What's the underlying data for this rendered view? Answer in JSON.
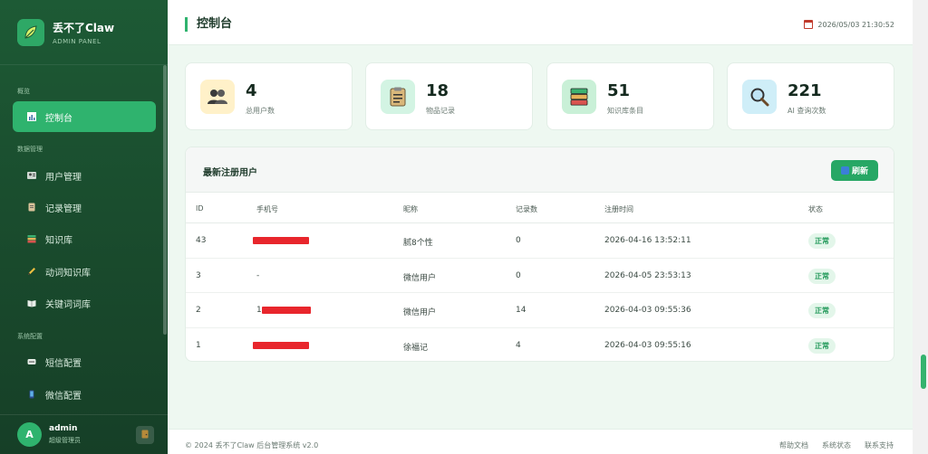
{
  "brand": {
    "title": "丢不了Claw",
    "subtitle": "ADMIN PANEL"
  },
  "sidebar": {
    "sections": [
      {
        "label": "概览"
      },
      {
        "label": "数据管理"
      },
      {
        "label": "系统配置"
      }
    ],
    "items": [
      {
        "label": "控制台",
        "icon": "chart-icon",
        "active": true
      },
      {
        "label": "用户管理",
        "icon": "users-icon"
      },
      {
        "label": "记录管理",
        "icon": "clipboard-icon"
      },
      {
        "label": "知识库",
        "icon": "books-icon"
      },
      {
        "label": "动词知识库",
        "icon": "pencil-icon"
      },
      {
        "label": "关键词词库",
        "icon": "book-icon"
      },
      {
        "label": "短信配置",
        "icon": "sms-icon"
      },
      {
        "label": "微信配置",
        "icon": "phone-icon"
      }
    ],
    "user": {
      "initial": "A",
      "name": "admin",
      "role": "超级管理员"
    }
  },
  "header": {
    "title": "控制台",
    "datetime": "2026/05/03 21:30:52"
  },
  "stats": [
    {
      "value": "4",
      "label": "总用户数",
      "icon": "users-icon",
      "color": "#fff1c9"
    },
    {
      "value": "18",
      "label": "物品记录",
      "icon": "clipboard-icon",
      "color": "#d3f4e3"
    },
    {
      "value": "51",
      "label": "知识库条目",
      "icon": "books-icon",
      "color": "#c9f0d7"
    },
    {
      "value": "221",
      "label": "AI 查询次数",
      "icon": "magnifier-icon",
      "color": "#cfeef8"
    }
  ],
  "table": {
    "title": "最新注册用户",
    "refresh_label": "刷新",
    "columns": [
      "ID",
      "手机号",
      "昵称",
      "记录数",
      "注册时间",
      "状态"
    ],
    "rows": [
      {
        "id": "43",
        "phone": "",
        "nickname": "腻8个性",
        "records": "0",
        "time": "2026-04-16 13:52:11",
        "status": "正常"
      },
      {
        "id": "3",
        "phone": "-",
        "nickname": "微信用户",
        "records": "0",
        "time": "2026-04-05 23:53:13",
        "status": "正常"
      },
      {
        "id": "2",
        "phone": "1",
        "nickname": "微信用户",
        "records": "14",
        "time": "2026-04-03 09:55:36",
        "status": "正常"
      },
      {
        "id": "1",
        "phone": "",
        "nickname": "徐福记",
        "records": "4",
        "time": "2026-04-03 09:55:16",
        "status": "正常"
      }
    ]
  },
  "footer": {
    "copyright": "© 2024 丢不了Claw 后台管理系统 v2.0",
    "links": [
      "帮助文档",
      "系统状态",
      "联系支持"
    ]
  },
  "colors": {
    "sidebar": "#1a4d2e",
    "accent": "#2fb36e",
    "badge_bg": "#e3f6ea",
    "redaction": "#e8262c"
  }
}
